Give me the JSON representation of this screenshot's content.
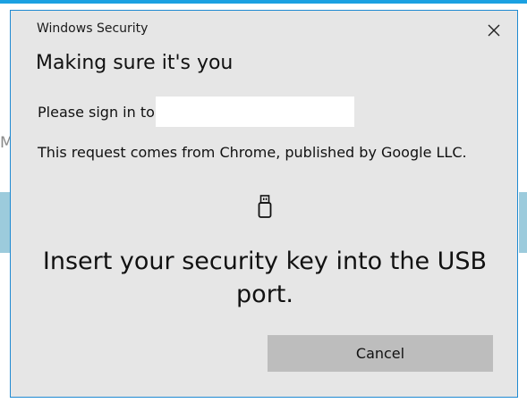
{
  "background": {
    "partial_letter": "M"
  },
  "dialog": {
    "window_title": "Windows Security",
    "heading": "Making sure it's you",
    "signin_label": "Please sign in to",
    "request_text": "This request comes from Chrome, published by Google LLC.",
    "icon": "usb-key-icon",
    "instruction": "Insert your security key into the USB port.",
    "cancel_label": "Cancel",
    "close_icon": "close-icon"
  },
  "colors": {
    "dialog_bg": "#e6e6e6",
    "dialog_border": "#1f8ad2",
    "button_bg": "#bdbdbd",
    "accent_top": "#1ba1e2"
  }
}
